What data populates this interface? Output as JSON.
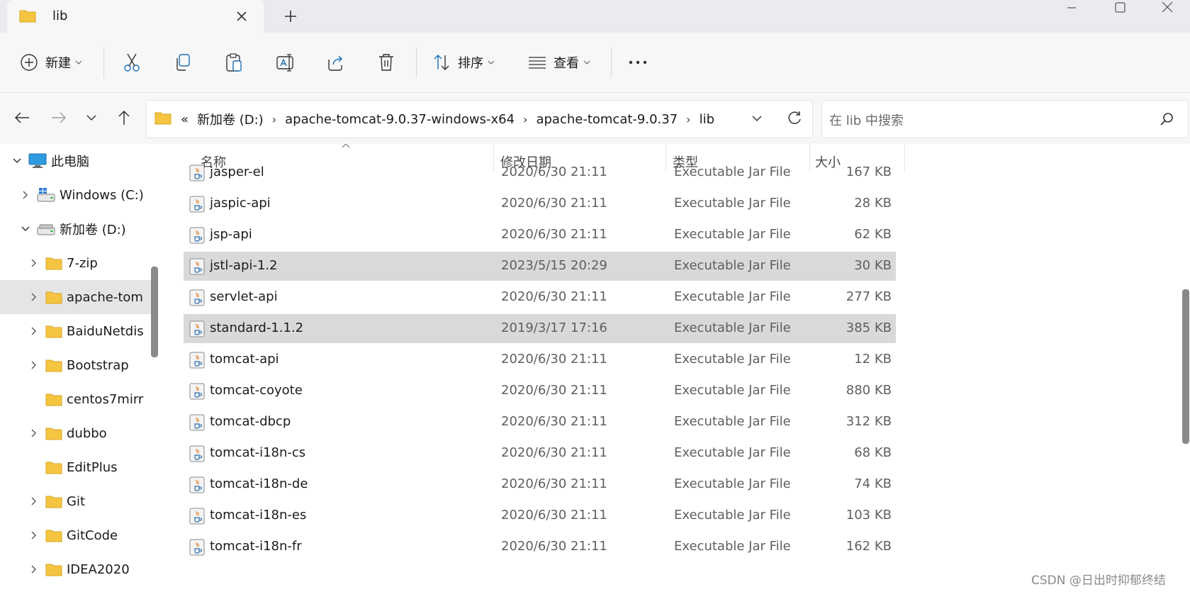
{
  "tab": {
    "title": "lib"
  },
  "commands": {
    "new_label": "新建",
    "sort_label": "排序",
    "view_label": "查看"
  },
  "address": {
    "overflow": "«",
    "crumbs": [
      "新加卷 (D:)",
      "apache-tomcat-9.0.37-windows-x64",
      "apache-tomcat-9.0.37",
      "lib"
    ],
    "search_placeholder": "在 lib 中搜索"
  },
  "sidebar": {
    "items": [
      {
        "label": "此电脑",
        "icon": "computer-icon",
        "expanded": true
      },
      {
        "label": "Windows (C:)",
        "icon": "windows-drive-icon",
        "expanded": false
      },
      {
        "label": "新加卷 (D:)",
        "icon": "drive-icon",
        "expanded": true
      },
      {
        "label": "7-zip",
        "icon": "folder-icon"
      },
      {
        "label": "apache-tom",
        "icon": "folder-icon",
        "selected": true
      },
      {
        "label": "BaiduNetdis",
        "icon": "folder-icon"
      },
      {
        "label": "Bootstrap",
        "icon": "folder-icon"
      },
      {
        "label": "centos7mirr",
        "icon": "folder-icon"
      },
      {
        "label": "dubbo",
        "icon": "folder-icon"
      },
      {
        "label": "EditPlus",
        "icon": "folder-icon"
      },
      {
        "label": "Git",
        "icon": "folder-icon"
      },
      {
        "label": "GitCode",
        "icon": "folder-icon"
      },
      {
        "label": "IDEA2020",
        "icon": "folder-icon"
      }
    ]
  },
  "columns": {
    "name": "名称",
    "date": "修改日期",
    "type": "类型",
    "size": "大小"
  },
  "files": [
    {
      "name": "jasper-el",
      "date": "2020/6/30 21:11",
      "type": "Executable Jar File",
      "size": "167 KB"
    },
    {
      "name": "jaspic-api",
      "date": "2020/6/30 21:11",
      "type": "Executable Jar File",
      "size": "28 KB"
    },
    {
      "name": "jsp-api",
      "date": "2020/6/30 21:11",
      "type": "Executable Jar File",
      "size": "62 KB"
    },
    {
      "name": "jstl-api-1.2",
      "date": "2023/5/15 20:29",
      "type": "Executable Jar File",
      "size": "30 KB",
      "selected": true
    },
    {
      "name": "servlet-api",
      "date": "2020/6/30 21:11",
      "type": "Executable Jar File",
      "size": "277 KB"
    },
    {
      "name": "standard-1.1.2",
      "date": "2019/3/17 17:16",
      "type": "Executable Jar File",
      "size": "385 KB",
      "selected": true
    },
    {
      "name": "tomcat-api",
      "date": "2020/6/30 21:11",
      "type": "Executable Jar File",
      "size": "12 KB"
    },
    {
      "name": "tomcat-coyote",
      "date": "2020/6/30 21:11",
      "type": "Executable Jar File",
      "size": "880 KB"
    },
    {
      "name": "tomcat-dbcp",
      "date": "2020/6/30 21:11",
      "type": "Executable Jar File",
      "size": "312 KB"
    },
    {
      "name": "tomcat-i18n-cs",
      "date": "2020/6/30 21:11",
      "type": "Executable Jar File",
      "size": "68 KB"
    },
    {
      "name": "tomcat-i18n-de",
      "date": "2020/6/30 21:11",
      "type": "Executable Jar File",
      "size": "74 KB"
    },
    {
      "name": "tomcat-i18n-es",
      "date": "2020/6/30 21:11",
      "type": "Executable Jar File",
      "size": "103 KB"
    },
    {
      "name": "tomcat-i18n-fr",
      "date": "2020/6/30 21:11",
      "type": "Executable Jar File",
      "size": "162 KB"
    }
  ],
  "watermark": "CSDN @日出时抑郁终结",
  "colors": {
    "folder": "#f5c542",
    "selection": "#d9d9d9",
    "chrome": "#f7f7f7"
  }
}
